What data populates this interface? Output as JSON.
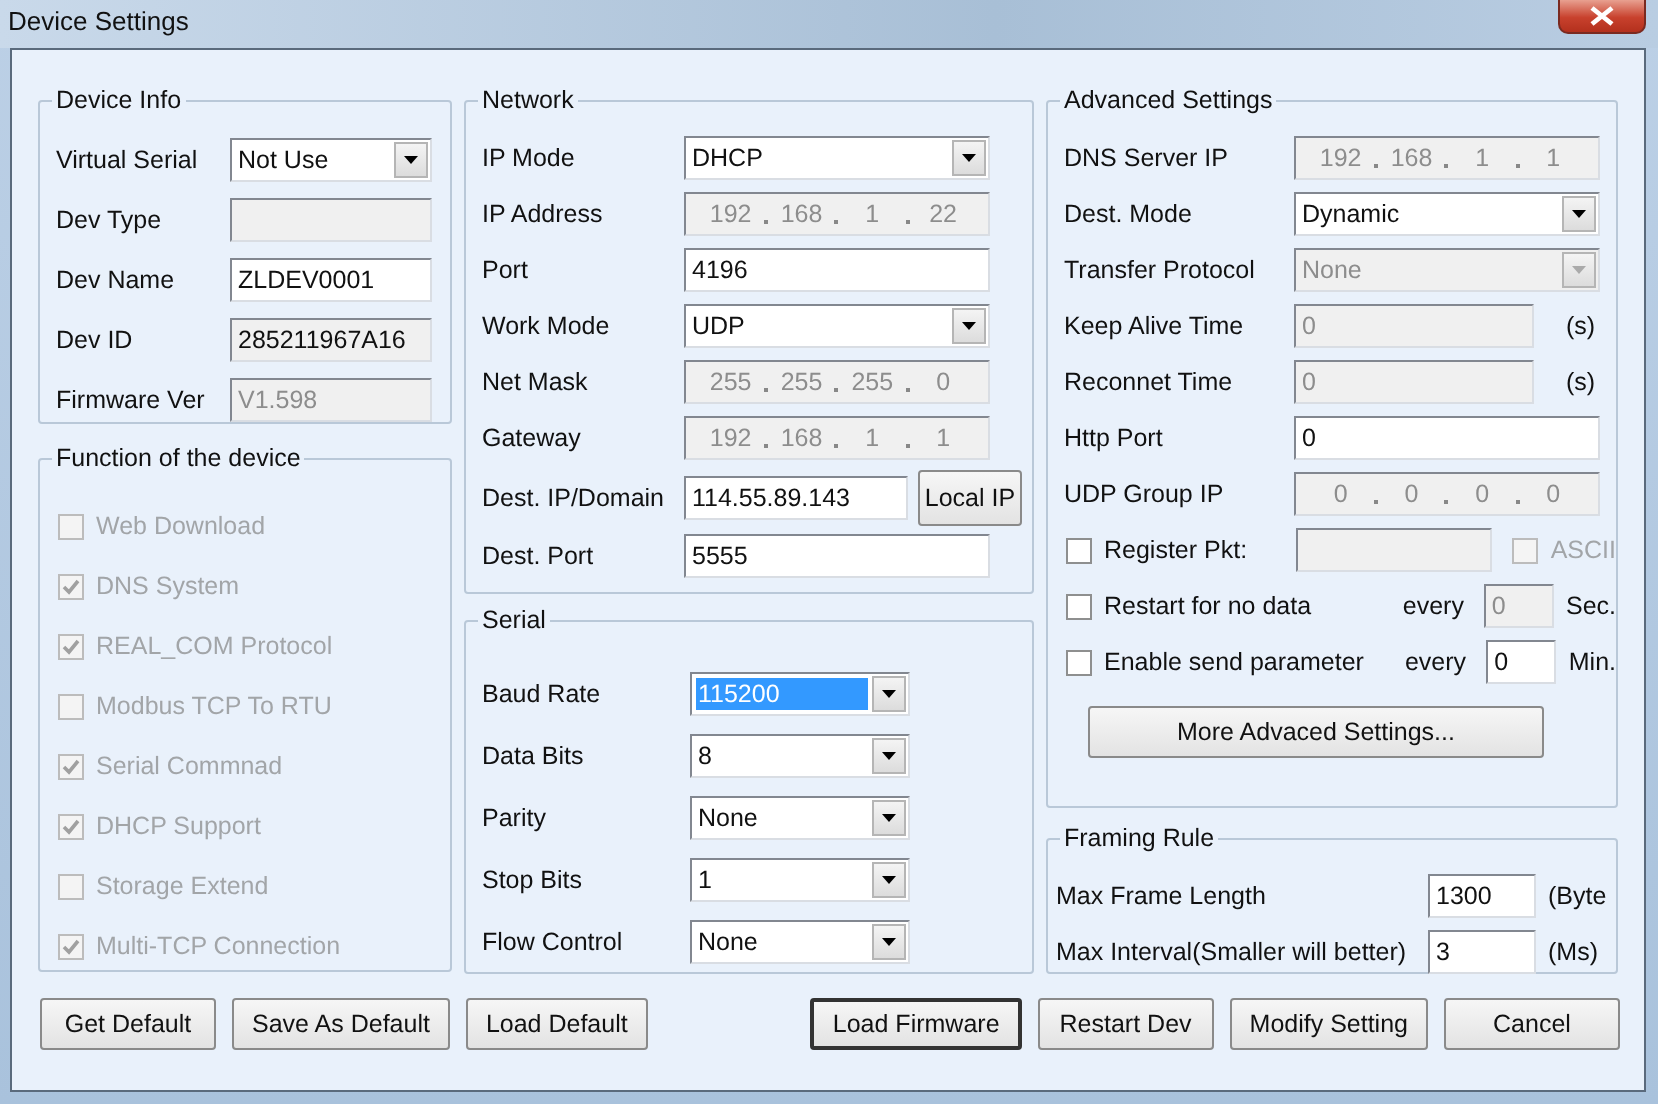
{
  "window": {
    "title": "Device Settings"
  },
  "device_info": {
    "title": "Device Info",
    "rows": [
      {
        "label": "Virtual Serial",
        "kind": "select",
        "value": "Not Use",
        "disabled": false
      },
      {
        "label": "Dev Type",
        "kind": "text",
        "disabled": true
      },
      {
        "label": "Dev Name",
        "kind": "text",
        "value": "ZLDEV0001",
        "disabled": false
      },
      {
        "label": "Dev ID",
        "kind": "text",
        "value": "285211967A16",
        "disabled": false,
        "readonly": true
      },
      {
        "label": "Firmware Ver",
        "kind": "text",
        "value": "V1.598",
        "disabled": true
      }
    ]
  },
  "functions": {
    "title": "Function of the device",
    "items": [
      {
        "label": "Web Download",
        "checked": false,
        "disabled": true
      },
      {
        "label": "DNS System",
        "checked": true,
        "disabled": true
      },
      {
        "label": "REAL_COM Protocol",
        "checked": true,
        "disabled": true
      },
      {
        "label": "Modbus TCP To RTU",
        "checked": false,
        "disabled": true
      },
      {
        "label": "Serial Commnad",
        "checked": true,
        "disabled": true
      },
      {
        "label": "DHCP Support",
        "checked": true,
        "disabled": true
      },
      {
        "label": "Storage Extend",
        "checked": false,
        "disabled": true
      },
      {
        "label": "Multi-TCP Connection",
        "checked": true,
        "disabled": true
      }
    ]
  },
  "network": {
    "title": "Network",
    "rows": [
      {
        "label": "IP Mode",
        "kind": "select",
        "value": "DHCP",
        "disabled": false
      },
      {
        "label": "IP Address",
        "kind": "ip",
        "octets": [
          "192",
          "168",
          "1",
          "22"
        ],
        "disabled": true
      },
      {
        "label": "Port",
        "kind": "text",
        "value": "4196",
        "disabled": false
      },
      {
        "label": "Work Mode",
        "kind": "select",
        "value": "UDP",
        "disabled": false
      },
      {
        "label": "Net Mask",
        "kind": "ip",
        "octets": [
          "255",
          "255",
          "255",
          "0"
        ],
        "disabled": true
      },
      {
        "label": "Gateway",
        "kind": "ip",
        "octets": [
          "192",
          "168",
          "1",
          "1"
        ],
        "disabled": true
      },
      {
        "label": "Dest. IP/Domain",
        "kind": "text",
        "value": "114.55.89.143",
        "disabled": false,
        "button": "Local IP"
      },
      {
        "label": "Dest. Port",
        "kind": "text",
        "value": "5555",
        "disabled": false
      }
    ]
  },
  "serial": {
    "title": "Serial",
    "rows": [
      {
        "label": "Baud Rate",
        "value": "115200",
        "highlighted": true
      },
      {
        "label": "Data Bits",
        "value": "8",
        "highlighted": false
      },
      {
        "label": "Parity",
        "value": "None",
        "highlighted": false
      },
      {
        "label": "Stop Bits",
        "value": "1",
        "highlighted": false
      },
      {
        "label": "Flow Control",
        "value": "None",
        "highlighted": false
      }
    ]
  },
  "advanced": {
    "title": "Advanced Settings",
    "rows": [
      {
        "label": "DNS Server IP",
        "kind": "ip",
        "octets": [
          "192",
          "168",
          "1",
          "1"
        ],
        "disabled": true
      },
      {
        "label": "Dest. Mode",
        "kind": "select",
        "value": "Dynamic",
        "disabled": false
      },
      {
        "label": "Transfer Protocol",
        "kind": "select",
        "value": "None",
        "disabled": true
      },
      {
        "label": "Keep Alive Time",
        "kind": "text",
        "value": "0",
        "disabled": true,
        "unit": "(s)"
      },
      {
        "label": "Reconnet Time",
        "kind": "text",
        "value": "0",
        "disabled": true,
        "unit": "(s)"
      },
      {
        "label": "Http Port",
        "kind": "text",
        "value": "0",
        "disabled": false
      },
      {
        "label": "UDP Group IP",
        "kind": "ip",
        "octets": [
          "0",
          "0",
          "0",
          "0"
        ],
        "disabled": true
      },
      {
        "label": "Register Pkt:",
        "kind": "check_field",
        "checked": false,
        "disabled": true,
        "option": {
          "label": "ASCII",
          "checked": false,
          "disabled": true
        }
      },
      {
        "label": "Restart for no data",
        "kind": "check_every",
        "checked": false,
        "every": "every",
        "value": "0",
        "disabled": true,
        "unit": "Sec."
      },
      {
        "label": "Enable send parameter",
        "kind": "check_every",
        "checked": false,
        "every": "every",
        "value": "0",
        "disabled": false,
        "unit": "Min."
      }
    ],
    "more_button": "More Advaced Settings..."
  },
  "framing": {
    "title": "Framing Rule",
    "rows": [
      {
        "label": "Max Frame Length",
        "value": "1300",
        "unit": "(Byte"
      },
      {
        "label": "Max Interval(Smaller will better)",
        "value": "3",
        "unit": "(Ms)"
      }
    ]
  },
  "buttons_left": [
    {
      "label": "Get Default",
      "focused": false
    },
    {
      "label": "Save As Default",
      "focused": false
    },
    {
      "label": "Load Default",
      "focused": false
    }
  ],
  "buttons_right": [
    {
      "label": "Load Firmware",
      "focused": true
    },
    {
      "label": "Restart Dev",
      "focused": false
    },
    {
      "label": "Modify Setting",
      "focused": false
    },
    {
      "label": "Cancel",
      "focused": false
    }
  ]
}
